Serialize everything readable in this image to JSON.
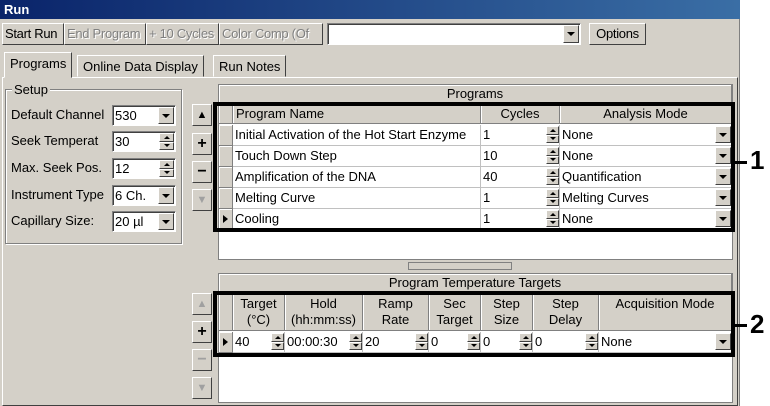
{
  "window": {
    "title": "Run"
  },
  "toolbar": {
    "start_run": "Start Run",
    "end_program": "End Program",
    "plus_10_cycles": "+ 10 Cycles",
    "color_comp": "Color Comp (Of",
    "program_select_value": "",
    "options": "Options"
  },
  "tabs": [
    "Programs",
    "Online Data Display",
    "Run Notes"
  ],
  "setup": {
    "legend": "Setup",
    "default_channel_label": "Default Channel",
    "default_channel_value": "530",
    "seek_temperature_label": "Seek Temperat",
    "seek_temperature_value": "30",
    "max_seek_pos_label": "Max. Seek Pos.",
    "max_seek_pos_value": "12",
    "instrument_type_label": "Instrument Type",
    "instrument_type_value": "6 Ch.",
    "capillary_size_label": "Capillary Size:",
    "capillary_size_value": "20 µl"
  },
  "programs": {
    "title": "Programs",
    "columns": [
      "Program Name",
      "Cycles",
      "Analysis Mode"
    ],
    "rows": [
      {
        "name": "Initial Activation of the Hot Start Enzyme",
        "cycles": "1",
        "mode": "None"
      },
      {
        "name": "Touch Down Step",
        "cycles": "10",
        "mode": "None"
      },
      {
        "name": "Amplification of the DNA",
        "cycles": "40",
        "mode": "Quantification"
      },
      {
        "name": "Melting Curve",
        "cycles": "1",
        "mode": "Melting Curves"
      },
      {
        "name": "Cooling",
        "cycles": "1",
        "mode": "None"
      }
    ]
  },
  "targets": {
    "title": "Program Temperature Targets",
    "columns": [
      {
        "l1": "Target",
        "l2": "(°C)"
      },
      {
        "l1": "Hold",
        "l2": "(hh:mm:ss)"
      },
      {
        "l1": "Ramp",
        "l2": "Rate"
      },
      {
        "l1": "Sec",
        "l2": "Target"
      },
      {
        "l1": "Step",
        "l2": "Size"
      },
      {
        "l1": "Step",
        "l2": "Delay"
      },
      {
        "l1": "Acquisition Mode",
        "l2": ""
      }
    ],
    "row": {
      "target": "40",
      "hold": "00:00:30",
      "ramp": "20",
      "sec_target": "0",
      "step_size": "0",
      "step_delay": "0",
      "acquisition": "None"
    }
  },
  "callouts": {
    "one": "1",
    "two": "2"
  },
  "side_buttons": {
    "up": "▲",
    "plus": "+",
    "minus": "−",
    "down": "▼"
  }
}
